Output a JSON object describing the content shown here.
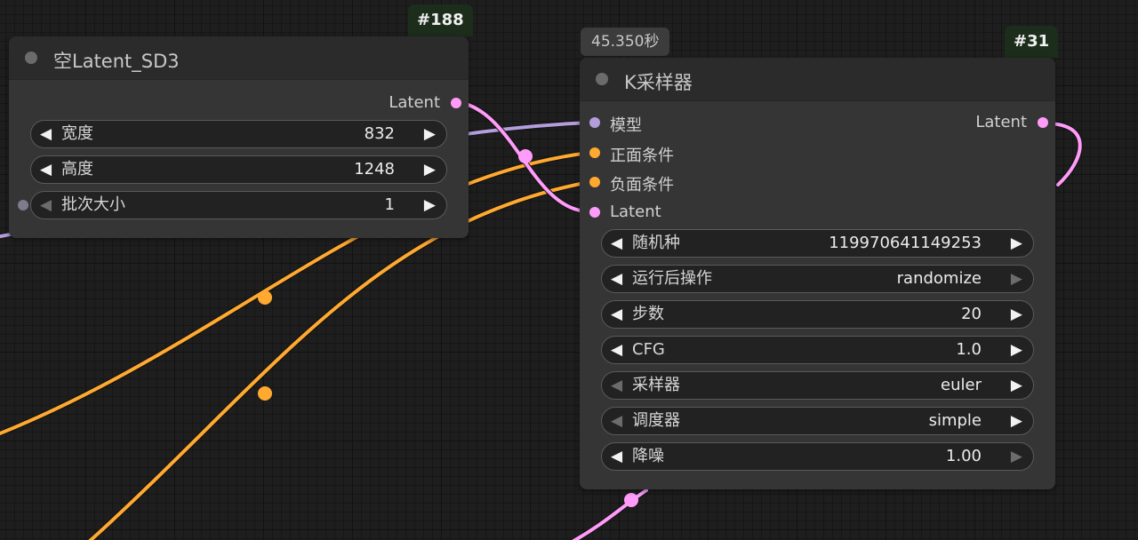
{
  "canvas": {
    "link_colors": {
      "model": "#b39ddb",
      "conditioning": "#ffa931",
      "latent": "#ff9cf9"
    }
  },
  "node_188": {
    "id_badge": "#188",
    "title": "空Latent_SD3",
    "output_label": "Latent",
    "widgets": [
      {
        "label": "宽度",
        "value": "832"
      },
      {
        "label": "高度",
        "value": "1248"
      },
      {
        "label": "批次大小",
        "value": "1"
      }
    ]
  },
  "node_31": {
    "id_badge": "#31",
    "exec_time": "45.350秒",
    "title": "K采样器",
    "inputs": [
      {
        "label": "模型",
        "type": "model"
      },
      {
        "label": "正面条件",
        "type": "conditioning"
      },
      {
        "label": "负面条件",
        "type": "conditioning"
      },
      {
        "label": "Latent",
        "type": "latent"
      }
    ],
    "output_label": "Latent",
    "widgets": [
      {
        "label": "随机种",
        "value": "119970641149253"
      },
      {
        "label": "运行后操作",
        "value": "randomize"
      },
      {
        "label": "步数",
        "value": "20"
      },
      {
        "label": "CFG",
        "value": "1.0"
      },
      {
        "label": "采样器",
        "value": "euler"
      },
      {
        "label": "调度器",
        "value": "simple"
      },
      {
        "label": "降噪",
        "value": "1.00"
      }
    ]
  }
}
